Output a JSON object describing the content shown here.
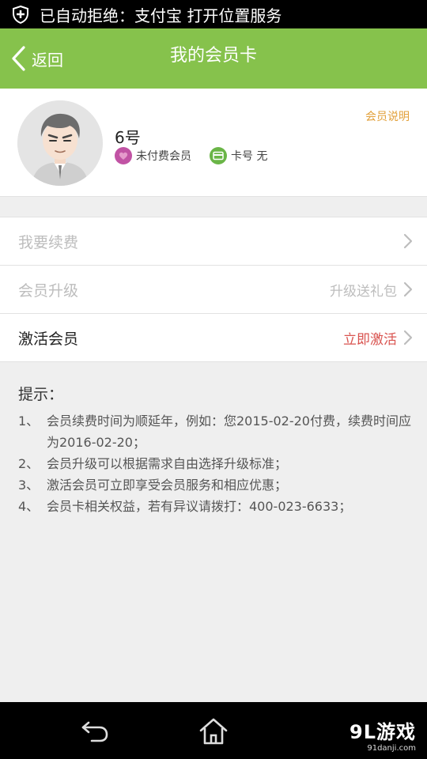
{
  "status_bar": {
    "text": "已自动拒绝：支付宝 打开位置服务",
    "icon": "shield-icon"
  },
  "header": {
    "back_label": "返回",
    "title": "我的会员卡"
  },
  "profile": {
    "name": "6号",
    "member_status": "未付费会员",
    "card_number": "卡号 无",
    "member_desc_link": "会员说明"
  },
  "menu": {
    "items": [
      {
        "label": "我要续费",
        "right_text": ""
      },
      {
        "label": "会员升级",
        "right_text": "升级送礼包"
      },
      {
        "label": "激活会员",
        "right_text": "立即激活"
      }
    ]
  },
  "tips": {
    "heading": "提示：",
    "items": [
      {
        "num": "1、",
        "text": "会员续费时间为顺延年，例如：您2015-02-20付费，续费时间应为2016-02-20；"
      },
      {
        "num": "2、",
        "text": "会员升级可以根据需求自由选择升级标准；"
      },
      {
        "num": "3、",
        "text": "激活会员可立即享受会员服务和相应优惠；"
      },
      {
        "num": "4、",
        "text": "会员卡相关权益，若有异议请拨打：400-023-6633；"
      }
    ]
  },
  "watermark": {
    "brand": "9L游戏",
    "site": "91danji.com"
  },
  "colors": {
    "accent_green": "#86c24c",
    "link_orange": "#e2a03a",
    "activate_red": "#d9534f",
    "disabled_gray": "#bdbdbd"
  }
}
